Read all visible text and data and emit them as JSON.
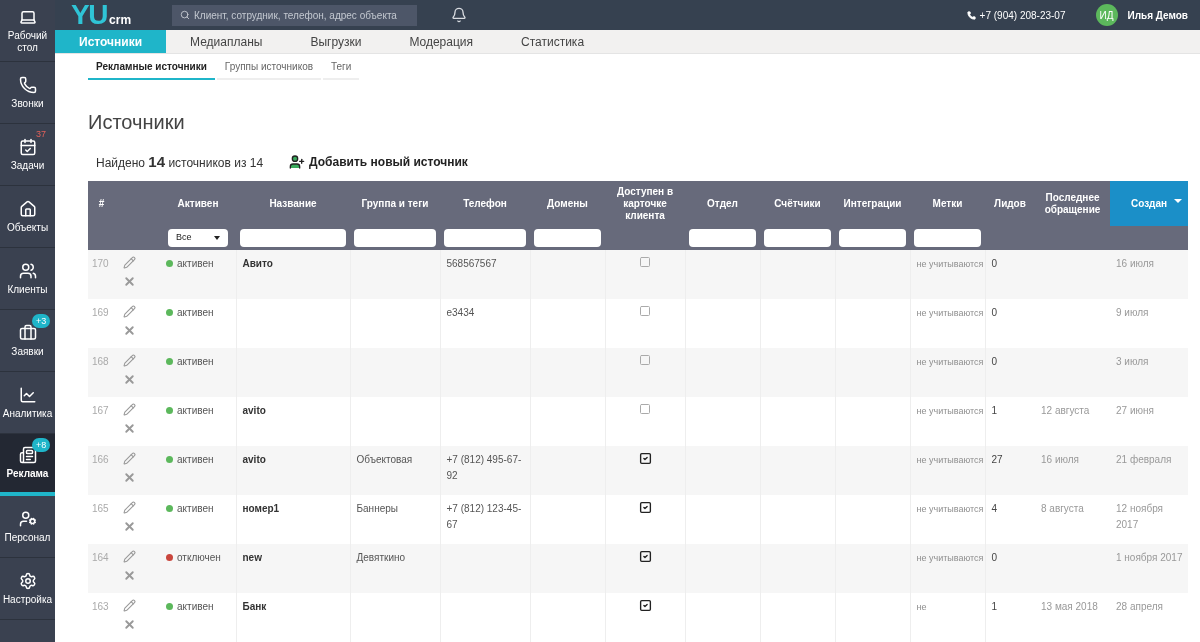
{
  "sidebar": {
    "items": [
      {
        "label": "Рабочий стол",
        "selected": false
      },
      {
        "label": "Звонки",
        "selected": false
      },
      {
        "label": "Задачи",
        "selected": false,
        "badge": {
          "text": "37",
          "kind": "count"
        }
      },
      {
        "label": "Объекты",
        "selected": false
      },
      {
        "label": "Клиенты",
        "selected": false
      },
      {
        "label": "Заявки",
        "selected": false,
        "badge": {
          "text": "+3",
          "kind": "new"
        }
      },
      {
        "label": "Аналитика",
        "selected": false
      },
      {
        "label": "Реклама",
        "selected": true,
        "badge": {
          "text": "+8",
          "kind": "new"
        }
      },
      {
        "label": "Персонал",
        "selected": false
      },
      {
        "label": "Настройка",
        "selected": false
      }
    ]
  },
  "header": {
    "logo": {
      "mark": "YU",
      "text": "crm"
    },
    "search": {
      "placeholder": "Клиент, сотрудник, телефон, адрес объекта"
    },
    "phone": "+7 (904) 208-23-07",
    "user": {
      "initials": "ИД",
      "name": "Илья Демов"
    }
  },
  "tabs": [
    {
      "label": "Источники",
      "selected": true
    },
    {
      "label": "Медиапланы",
      "selected": false
    },
    {
      "label": "Выгрузки",
      "selected": false
    },
    {
      "label": "Модерация",
      "selected": false
    },
    {
      "label": "Статистика",
      "selected": false
    }
  ],
  "subtabs": [
    {
      "label": "Рекламные источники",
      "selected": true
    },
    {
      "label": "Группы источников",
      "selected": false
    },
    {
      "label": "Теги",
      "selected": false
    }
  ],
  "title": "Источники",
  "found": "Найдено **14** источников из 14",
  "add_button": "Добавить новый источник",
  "table": {
    "columns": [
      {
        "label": "#",
        "kind": "plain",
        "sorted": false
      },
      {
        "label": "Активен",
        "kind": "select",
        "value": "Все",
        "sorted": false
      },
      {
        "label": "Название",
        "kind": "text",
        "sorted": false
      },
      {
        "label": "Группа и теги",
        "kind": "text",
        "sorted": false
      },
      {
        "label": "Телефон",
        "kind": "text",
        "sorted": false
      },
      {
        "label": "Домены",
        "kind": "text",
        "sorted": false
      },
      {
        "label": "Доступен в карточке клиента",
        "kind": "plain",
        "sorted": false
      },
      {
        "label": "Отдел",
        "kind": "text",
        "sorted": false
      },
      {
        "label": "Счётчики",
        "kind": "text",
        "sorted": false
      },
      {
        "label": "Интеграции",
        "kind": "text",
        "sorted": false
      },
      {
        "label": "Метки",
        "kind": "text",
        "sorted": false
      },
      {
        "label": "Лидов",
        "kind": "plain",
        "sorted": false
      },
      {
        "label": "Последнее обращение",
        "kind": "plain",
        "sorted": false
      },
      {
        "label": "Создан",
        "kind": "plain",
        "sorted": true
      }
    ],
    "rows": [
      {
        "id": "170",
        "status": "активен",
        "active": true,
        "name": "Авито",
        "group": "",
        "phone": "568567567",
        "in_card": false,
        "marks": "не учитываются",
        "leads": "0",
        "last": "",
        "created": "16 июля"
      },
      {
        "id": "169",
        "status": "активен",
        "active": true,
        "name": "",
        "group": "",
        "phone": "e3434",
        "in_card": false,
        "marks": "не учитываются",
        "leads": "0",
        "last": "",
        "created": "9 июля"
      },
      {
        "id": "168",
        "status": "активен",
        "active": true,
        "name": "",
        "group": "",
        "phone": "",
        "in_card": false,
        "marks": "не учитываются",
        "leads": "0",
        "last": "",
        "created": "3 июля"
      },
      {
        "id": "167",
        "status": "активен",
        "active": true,
        "name": "avito",
        "group": "",
        "phone": "",
        "in_card": false,
        "marks": "не учитываются",
        "leads": "1",
        "last": "12 августа",
        "created": "27 июня"
      },
      {
        "id": "166",
        "status": "активен",
        "active": true,
        "name": "avito",
        "group": "Объектовая",
        "phone": "+7 (812) 495-67-92",
        "in_card": true,
        "marks": "не учитываются",
        "leads": "27",
        "last": "16 июля",
        "created": "21 февраля"
      },
      {
        "id": "165",
        "status": "активен",
        "active": true,
        "name": "номер1",
        "group": "Баннеры",
        "phone": "+7 (812) 123-45-67",
        "in_card": true,
        "marks": "не учитываются",
        "leads": "4",
        "last": "8 августа",
        "created": "12 ноября 2017"
      },
      {
        "id": "164",
        "status": "отключен",
        "active": false,
        "name": "new",
        "group": "Девяткино",
        "phone": "",
        "in_card": true,
        "marks": "не учитываются",
        "leads": "0",
        "last": "",
        "created": "1 ноября 2017"
      },
      {
        "id": "163",
        "status": "активен",
        "active": true,
        "name": "Банк",
        "group": "",
        "phone": "",
        "in_card": true,
        "marks": "не",
        "leads": "1",
        "last": "13 мая 2018",
        "created": "28 апреля"
      }
    ]
  }
}
